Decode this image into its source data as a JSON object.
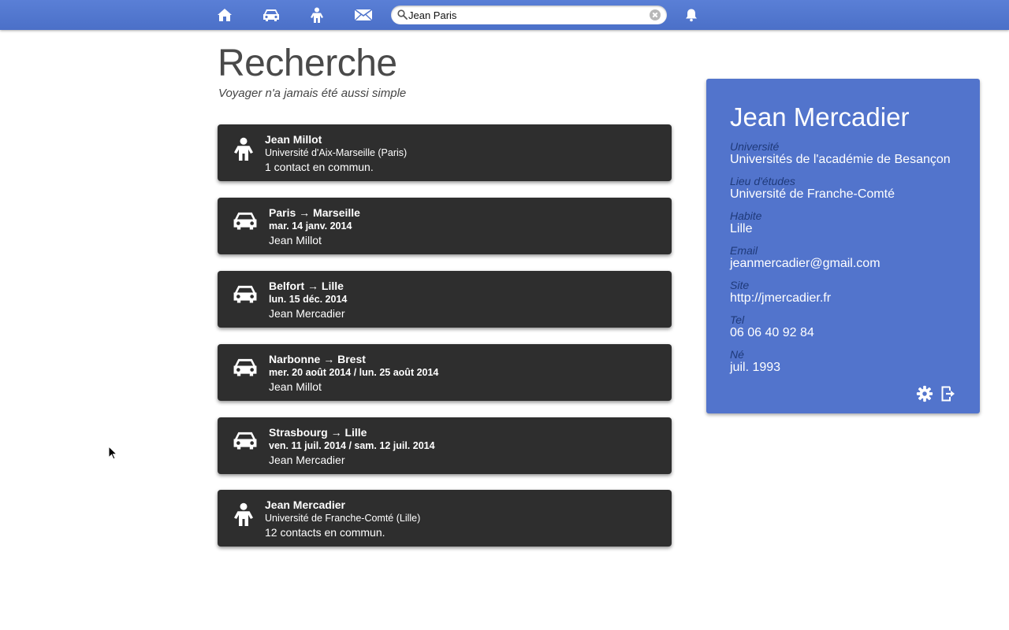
{
  "nav": {
    "items": [
      {
        "icon": "home-icon"
      },
      {
        "icon": "car-icon"
      },
      {
        "icon": "person-icon"
      },
      {
        "icon": "mail-icon"
      }
    ],
    "search": {
      "value": "Jean Paris",
      "placeholder": ""
    },
    "notifications_icon": "bell-icon",
    "color": "#4f74cc"
  },
  "page": {
    "title": "Recherche",
    "subtitle": "Voyager n'a jamais été aussi simple"
  },
  "results": [
    {
      "type": "person",
      "icon": "person-icon",
      "line1": "Jean Millot",
      "line2": "Université d'Aix-Marseille (Paris)",
      "line3": "1 contact en commun."
    },
    {
      "type": "trip",
      "icon": "car-icon",
      "line1": "Paris → Marseille",
      "line2": "mar. 14 janv. 2014",
      "line3": "Jean Millot"
    },
    {
      "type": "trip",
      "icon": "car-icon",
      "line1": "Belfort → Lille",
      "line2": "lun. 15 déc. 2014",
      "line3": "Jean Mercadier"
    },
    {
      "type": "trip",
      "icon": "car-icon",
      "line1": "Narbonne → Brest",
      "line2": "mer. 20 août 2014 / lun. 25 août 2014",
      "line3": "Jean Millot"
    },
    {
      "type": "trip",
      "icon": "car-icon",
      "line1": "Strasbourg → Lille",
      "line2": "ven. 11 juil. 2014 / sam. 12 juil. 2014",
      "line3": "Jean Mercadier"
    },
    {
      "type": "person",
      "icon": "person-icon",
      "line1": "Jean Mercadier",
      "line2": "Université de Franche-Comté (Lille)",
      "line3": "12 contacts en commun."
    }
  ],
  "profile": {
    "name": "Jean Mercadier",
    "fields": [
      {
        "label": "Université",
        "value": "Universités de l'académie de Besançon"
      },
      {
        "label": "Lieu d'études",
        "value": "Université de Franche-Comté"
      },
      {
        "label": "Habite",
        "value": "Lille"
      },
      {
        "label": "Email",
        "value": "jeanmercadier@gmail.com"
      },
      {
        "label": "Site",
        "value": "http://jmercadier.fr"
      },
      {
        "label": "Tel",
        "value": "06 06 40 92 84"
      },
      {
        "label": "Né",
        "value": "juil. 1993"
      }
    ],
    "actions": [
      {
        "icon": "gear-icon"
      },
      {
        "icon": "logout-icon"
      }
    ],
    "color": "#5274cc"
  }
}
